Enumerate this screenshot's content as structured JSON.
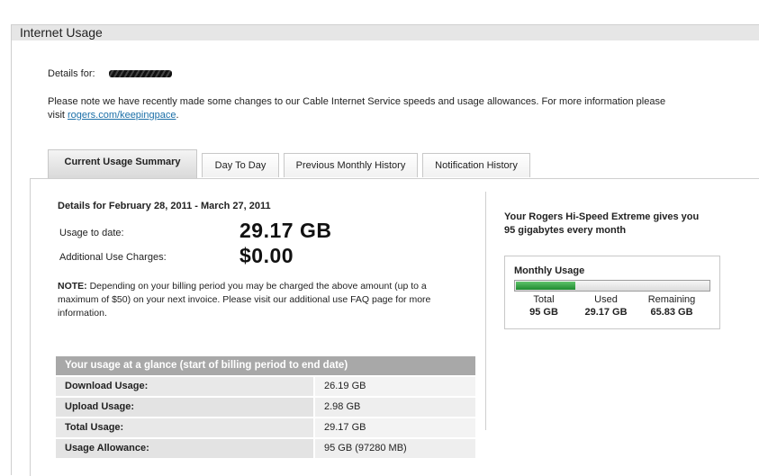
{
  "header": {
    "title": "Internet Usage"
  },
  "details_for": {
    "label": "Details for:"
  },
  "notice": {
    "text_before": "Please note we have recently made some changes to our Cable Internet Service speeds and usage allowances. For more information please visit ",
    "link_text": "rogers.com/keepingpace",
    "text_after": "."
  },
  "tabs": [
    {
      "label": "Current Usage Summary",
      "active": true
    },
    {
      "label": "Day To Day",
      "active": false
    },
    {
      "label": "Previous Monthly History",
      "active": false
    },
    {
      "label": "Notification History",
      "active": false
    }
  ],
  "summary": {
    "period": "Details for February 28, 2011 - March 27, 2011",
    "usage_to_date_label": "Usage to date:",
    "usage_to_date_value": "29.17 GB",
    "additional_charges_label": "Additional Use Charges:",
    "additional_charges_value": "$0.00",
    "note_bold": "NOTE:",
    "note_text": " Depending on your billing period you may be charged the above amount (up to a maximum of $50) on your next invoice. Please visit our additional use FAQ page for more information."
  },
  "glance": {
    "header": "Your usage at a glance (start of billing period to end date)",
    "rows": [
      {
        "label": "Download Usage:",
        "value": "26.19 GB"
      },
      {
        "label": "Upload Usage:",
        "value": "2.98 GB"
      },
      {
        "label": "Total Usage:",
        "value": "29.17 GB"
      },
      {
        "label": "Usage Allowance:",
        "value": "95 GB (97280 MB)"
      }
    ]
  },
  "promo": {
    "text": "Your Rogers Hi-Speed Extreme gives you 95 gigabytes every month"
  },
  "monthly_usage": {
    "title": "Monthly Usage",
    "fraction_used": 0.307,
    "total_label": "Total",
    "total_value": "95 GB",
    "used_label": "Used",
    "used_value": "29.17 GB",
    "remaining_label": "Remaining",
    "remaining_value": "65.83 GB"
  },
  "colors": {
    "link": "#1b6fa8",
    "bar_fill": "#2e9a3b",
    "table_header": "#a8a8a8"
  }
}
